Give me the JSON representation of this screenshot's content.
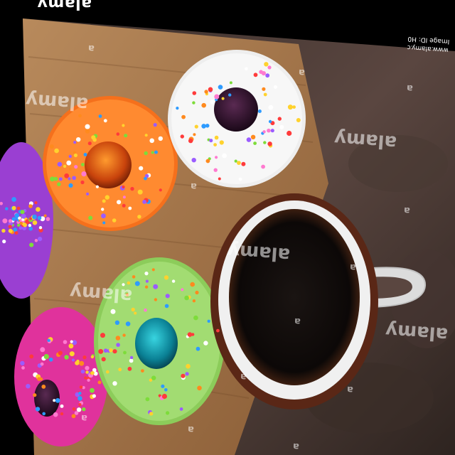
{
  "brand": "alamy",
  "corner": {
    "url": "www.alamy.c",
    "image_id": "Image ID: H0"
  },
  "watermark": {
    "word": "alamy",
    "letter": "a"
  }
}
